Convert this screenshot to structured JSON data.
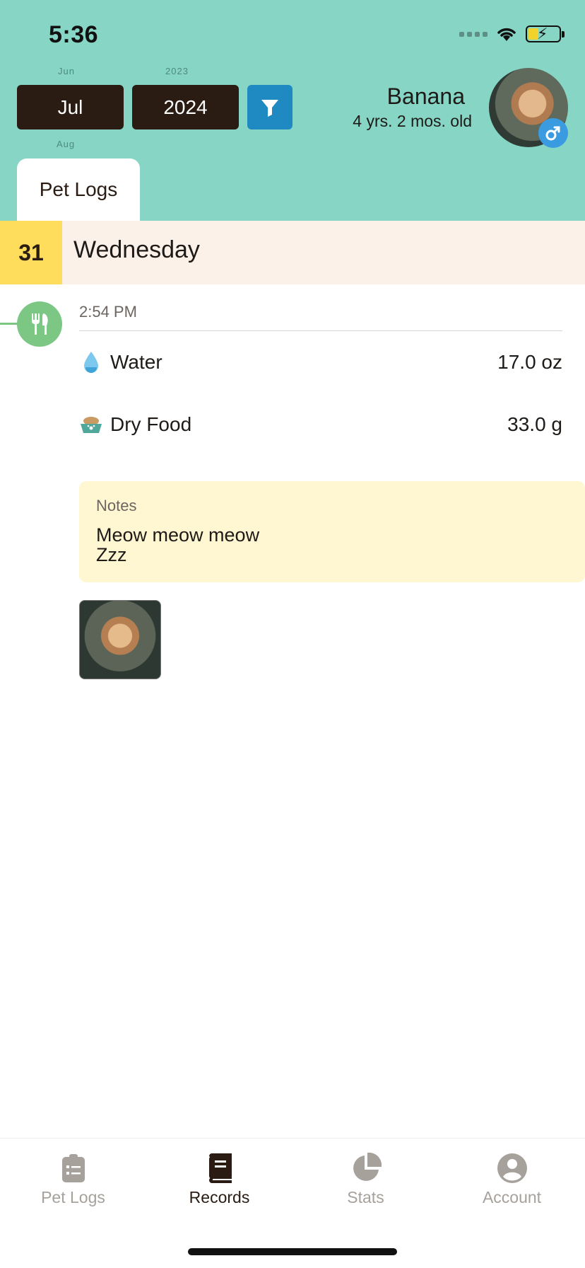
{
  "status_bar": {
    "time": "5:36"
  },
  "header": {
    "month_above": "Jun",
    "month": "Jul",
    "month_below": "Aug",
    "year_above": "2023",
    "year": "2024",
    "pet_name": "Banana",
    "pet_age": "4 yrs. 2 mos. old",
    "tab_label": "Pet Logs",
    "colors": {
      "header_bg": "#86d5c5",
      "picker_bg": "#2a1c13",
      "filter_bg": "#1f8ac2"
    }
  },
  "day": {
    "number": "31",
    "weekday": "Wednesday"
  },
  "entry": {
    "icon": "fork-knife-icon",
    "time": "2:54 PM",
    "items": [
      {
        "icon": "water-drop-icon",
        "label": "Water",
        "value": "17.0 oz"
      },
      {
        "icon": "food-bowl-icon",
        "label": "Dry Food",
        "value": "33.0 g"
      }
    ],
    "notes_title": "Notes",
    "notes_text": "Meow meow meow\nZzz"
  },
  "bottom_nav": [
    {
      "label": "Pet Logs",
      "icon": "clipboard-icon",
      "active": false
    },
    {
      "label": "Records",
      "icon": "book-icon",
      "active": true
    },
    {
      "label": "Stats",
      "icon": "pie-chart-icon",
      "active": false
    },
    {
      "label": "Account",
      "icon": "account-icon",
      "active": false
    }
  ]
}
